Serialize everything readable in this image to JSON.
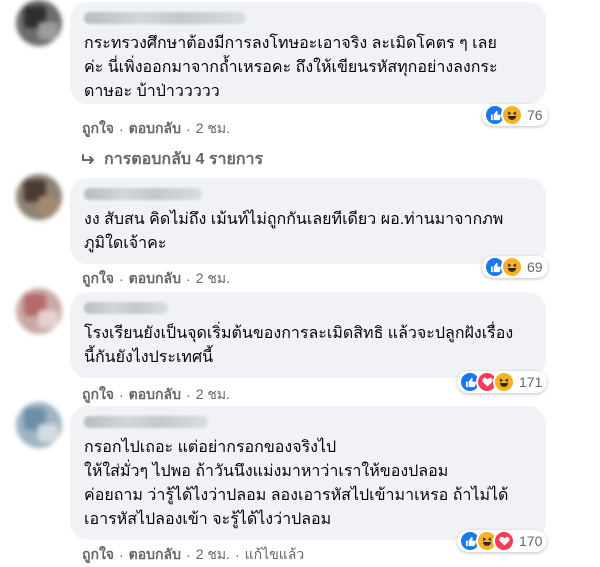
{
  "comments": [
    {
      "text": "กระทรวงศึกษาต้องมีการลงโทษอะเอาจริง ละเมิดโคตร ๆ เลย\nค่ะ นี่เพิ่งออกมาจากถ้ำเหรอคะ ถึงให้เขียนรหัสทุกอย่างลงกระ\nดาษอะ บ้าป่าววววว",
      "like": "ถูกใจ",
      "reply": "ตอบกลับ",
      "time": "2 ชม.",
      "reactions": [
        "like-icon",
        "haha-icon"
      ],
      "count": "76"
    },
    {
      "text": "งง สับสน คิดไม่ถึง เม้นท์ไม่ถูกกันเลยทีเดียว ผอ.ท่านมาจากภพ\nภูมิใดเจ้าคะ",
      "like": "ถูกใจ",
      "reply": "ตอบกลับ",
      "time": "2 ชม.",
      "reactions": [
        "like-icon",
        "haha-icon"
      ],
      "count": "69"
    },
    {
      "text": "โรงเรียนยังเป็นจุดเริ่มต้นของการละเมิดสิทธิ แล้วจะปลูกฝังเรื่อง\nนี้กันยังไงประเทศนี้",
      "like": "ถูกใจ",
      "reply": "ตอบกลับ",
      "time": "2 ชม.",
      "reactions": [
        "like-icon",
        "love-icon",
        "haha-icon"
      ],
      "count": "171"
    },
    {
      "text": "กรอกไปเถอะ แต่อย่ากรอกของจริงไป\nให้ใส่มั่วๆ ไปพอ ถ้าวันนึงแม่งมาหาว่าเราให้ของปลอม\nค่อยถาม ว่ารู้ได้ไงว่าปลอม ลองเอารหัสไปเข้ามาเหรอ ถ้าไม่ได้\nเอารหัสไปลองเข้า จะรู้ได้ไงว่าปลอม",
      "like": "ถูกใจ",
      "reply": "ตอบกลับ",
      "time": "2 ชม.",
      "edited": "แก้ไขแล้ว",
      "reactions": [
        "like-icon",
        "haha-icon",
        "love-icon"
      ],
      "count": "170"
    }
  ],
  "replies_label": "การตอบกลับ 4 รายการ",
  "separator": "·",
  "colors": {
    "bubble": "#f0f2f5",
    "meta": "#65676b",
    "like_blue": "#1877f2",
    "love_red": "#f33e58",
    "haha_yellow": "#f7b125"
  }
}
